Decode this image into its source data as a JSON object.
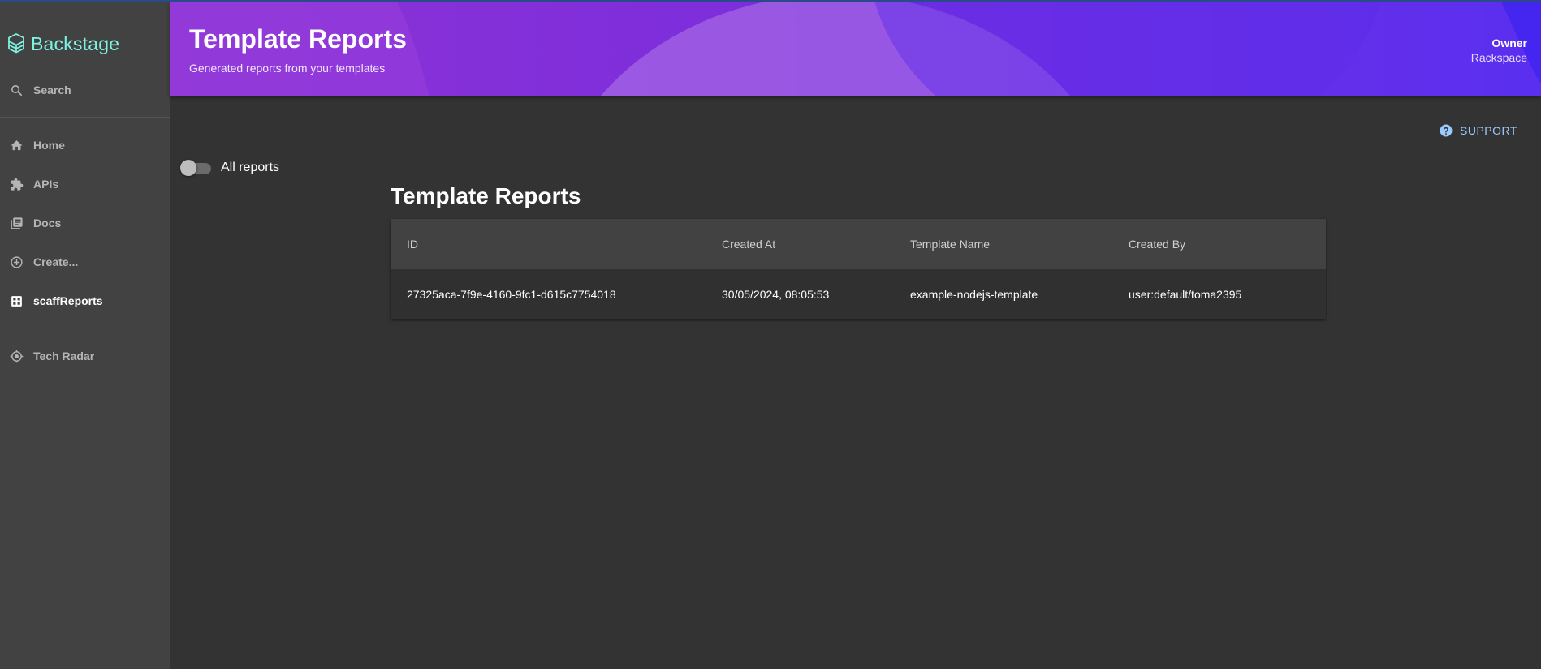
{
  "app": {
    "name": "Backstage"
  },
  "sidebar": {
    "items": [
      {
        "label": "Search",
        "icon": "search-icon"
      },
      {
        "label": "Home",
        "icon": "home-icon"
      },
      {
        "label": "APIs",
        "icon": "puzzle-icon"
      },
      {
        "label": "Docs",
        "icon": "library-books-icon"
      },
      {
        "label": "Create...",
        "icon": "add-circle-icon"
      },
      {
        "label": "scaffReports",
        "icon": "dashboard-icon",
        "active": true
      },
      {
        "label": "Tech Radar",
        "icon": "radar-icon"
      }
    ]
  },
  "header": {
    "title": "Template Reports",
    "subtitle": "Generated reports from your templates",
    "owner_label": "Owner",
    "owner_value": "Rackspace"
  },
  "support": {
    "label": "SUPPORT",
    "icon": "help-circle-icon"
  },
  "toggle": {
    "label": "All reports",
    "checked": false
  },
  "table": {
    "title": "Template Reports",
    "columns": [
      "ID",
      "Created At",
      "Template Name",
      "Created By"
    ],
    "rows": [
      [
        "27325aca-7f9e-4160-9fc1-d615c7754018",
        "30/05/2024, 08:05:53",
        "example-nodejs-template",
        "user:default/toma2395"
      ]
    ]
  },
  "colors": {
    "accent": "#7df3e1",
    "header_gradient_start": "#8c33d6",
    "header_gradient_end": "#5a2ff0",
    "support_link": "#9cc9ff",
    "background": "#333333",
    "sidebar": "#424242"
  }
}
